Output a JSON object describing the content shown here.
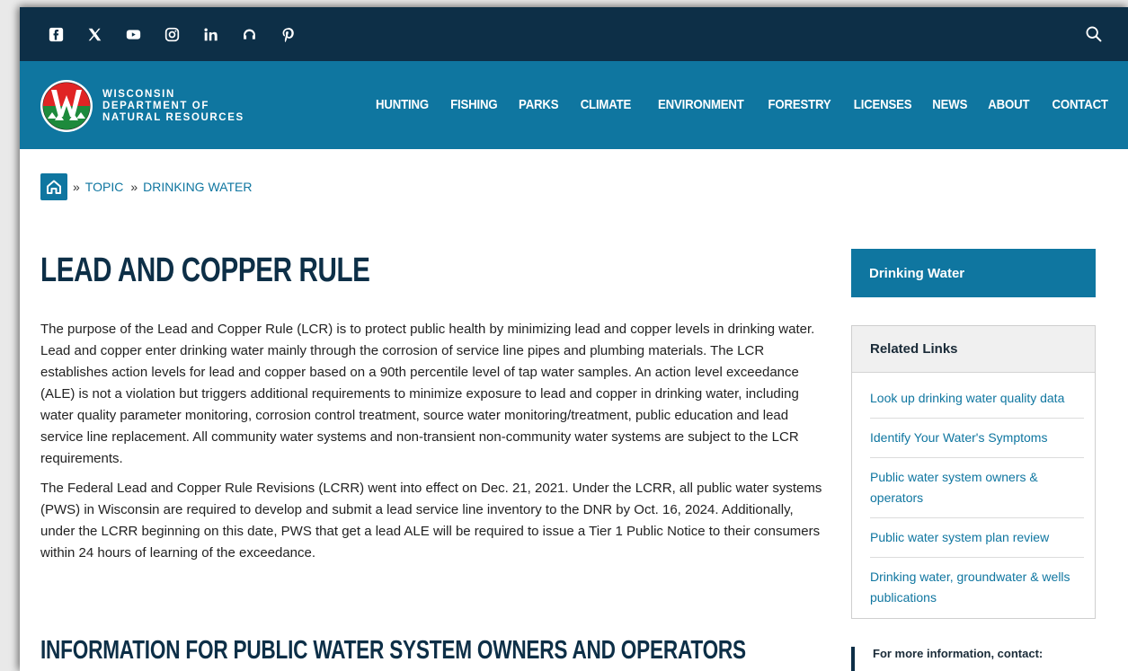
{
  "social": {
    "icons": [
      "facebook-icon",
      "x-icon",
      "youtube-icon",
      "instagram-icon",
      "linkedin-icon",
      "podcast-icon",
      "pinterest-icon"
    ]
  },
  "header": {
    "logo_line1": "WISCONSIN",
    "logo_line2": "DEPARTMENT OF",
    "logo_line3": "NATURAL RESOURCES",
    "nav": [
      "HUNTING",
      "FISHING",
      "PARKS",
      "CLIMATE",
      "ENVIRONMENT",
      "FORESTRY",
      "LICENSES",
      "NEWS",
      "ABOUT",
      "CONTACT"
    ]
  },
  "breadcrumb": {
    "sep": "»",
    "items": [
      "TOPIC",
      "DRINKING WATER"
    ]
  },
  "main": {
    "title": "LEAD AND COPPER RULE",
    "paragraph1": "The purpose of the Lead and Copper Rule (LCR) is to protect public health by minimizing lead and copper levels in drinking water. Lead and copper enter drinking water mainly through the corrosion of service line pipes and plumbing materials. The LCR establishes action levels for lead and copper based on a 90th percentile level of tap water samples. An action level exceedance (ALE) is not a violation but triggers additional requirements to minimize exposure to lead and copper in drinking water, including water quality parameter monitoring, corrosion control treatment, source water monitoring/treatment, public education and lead service line replacement. All community water systems and non-transient non-community water systems are subject to the LCR requirements.",
    "paragraph2": "The Federal Lead and Copper Rule Revisions (LCRR) went into effect on Dec. 21, 2021. Under the LCRR, all public water systems (PWS) in Wisconsin are required to develop and submit a lead service line inventory to the DNR by Oct. 16, 2024. Additionally, under the LCRR beginning on this date, PWS that get a lead ALE will be required to issue a Tier 1 Public Notice to their consumers within 24 hours of learning of the exceedance.",
    "section_title": "INFORMATION FOR PUBLIC WATER SYSTEM OWNERS AND OPERATORS"
  },
  "sidebar": {
    "topic": "Drinking Water",
    "related_title": "Related Links",
    "related_links": [
      "Look up drinking water quality data",
      "Identify Your Water's Symptoms",
      "Public water system owners & operators",
      "Public water system plan review",
      "Drinking water, groundwater & wells publications"
    ],
    "contact_title": "For more information, contact:"
  },
  "colors": {
    "top_bar": "#0d2f47",
    "brand_blue": "#0f76a0",
    "title_navy": "#0d2f47"
  }
}
